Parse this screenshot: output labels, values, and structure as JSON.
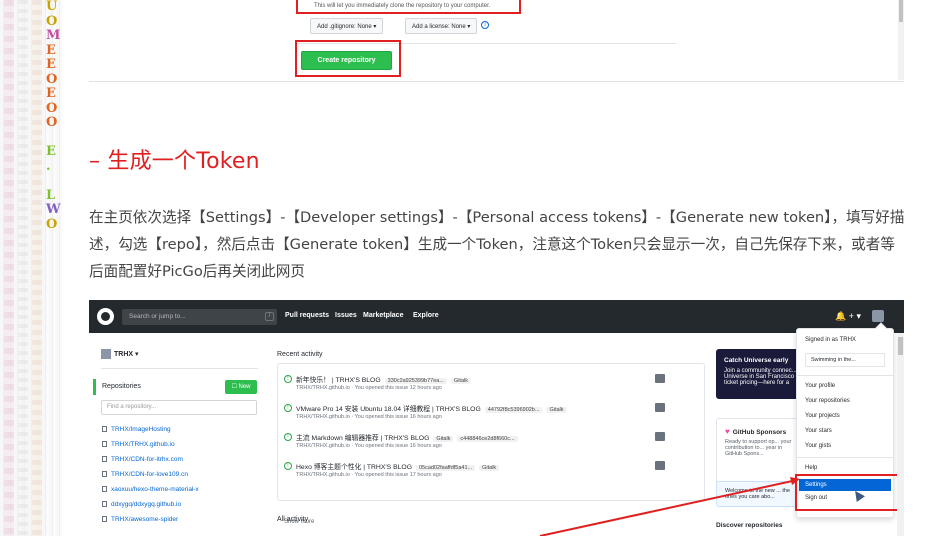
{
  "left_strip": {
    "letters": [
      {
        "ch": "U",
        "color": "#c9a400"
      },
      {
        "ch": "O",
        "color": "#c9a400"
      },
      {
        "ch": "M",
        "color": "#c24fa0"
      },
      {
        "ch": "E",
        "color": "#e0651f"
      },
      {
        "ch": "E",
        "color": "#e0651f"
      },
      {
        "ch": "O",
        "color": "#e0651f"
      },
      {
        "ch": "E",
        "color": "#e0651f"
      },
      {
        "ch": "O",
        "color": "#e0651f"
      },
      {
        "ch": "O",
        "color": "#e0651f"
      },
      {
        "ch": "",
        "color": "#999"
      },
      {
        "ch": "E",
        "color": "#80c030"
      },
      {
        "ch": ".",
        "color": "#80c030"
      },
      {
        "ch": "",
        "color": "#999"
      },
      {
        "ch": "L",
        "color": "#80c030"
      },
      {
        "ch": "W",
        "color": "#8060c0"
      },
      {
        "ch": "O",
        "color": "#c9a400"
      }
    ]
  },
  "top_screenshot": {
    "hint": "This will let you immediately clone the repository to your computer.",
    "gitignore_btn": "Add .gitignore: None ▾",
    "license_btn": "Add a license: None ▾",
    "info_icon": "i",
    "create_btn": "Create repository"
  },
  "article": {
    "heading": "– 生成一个Token",
    "paragraph": "在主页依次选择【Settings】-【Developer settings】-【Personal access tokens】-【Generate new token】，填写好描述，勾选【repo】，然后点击【Generate token】生成一个Token，注意这个Token只会显示一次，自己先保存下来，或者等后面配置好PicGo后再关闭此网页"
  },
  "github": {
    "search_placeholder": "Search or jump to...",
    "search_key": "/",
    "nav": [
      "Pull requests",
      "Issues",
      "Marketplace",
      "Explore"
    ],
    "header_right": "🔔  + ▾",
    "user": "TRHX ▾",
    "repos_title": "Repositories",
    "new_btn": "☐ New",
    "find_placeholder": "Find a repository...",
    "repos": [
      "TRHX/ImageHosting",
      "TRHX/TRHX.github.io",
      "TRHX/CDN-for-itrhx.com",
      "TRHX/CDN-for-love109.cn",
      "xaoxuu/hexo-theme-material-x",
      "ddxygq/ddxygq.github.io",
      "TRHX/awesome-spider"
    ],
    "recent_title": "Recent activity",
    "activities": [
      {
        "title": "新年快乐！ | TRHX'S BLOG",
        "tag1": "330c2a925399b77ea...",
        "tag2": "Gitalk",
        "sub": "TRHX/TRHX.github.io  ·  You opened this issue 12 hours ago"
      },
      {
        "title": "VMware Pro 14 安装 Ubuntu 18.04 详细教程 | TRHX'S BLOG",
        "tag1": "44792f8c5396902b...",
        "tag2": "Gitalk",
        "sub": "TRHX/TRHX.github.io  ·  You opened this issue 16 hours ago"
      },
      {
        "title": "主流 Markdown 编辑器推荐 | TRHX'S BLOG",
        "tag1": "Gitalk",
        "tag2": "c448846ce2d8f660c...",
        "sub": "TRHX/TRHX.github.io  ·  You opened this issue 16 hours ago"
      },
      {
        "title": "Hexo 博客主题个性化 | TRHX'S BLOG",
        "tag1": "05cad02faaffdf5a41...",
        "tag2": "Gitalk",
        "sub": "TRHX/TRHX.github.io  ·  You opened this issue 17 hours ago"
      }
    ],
    "show_more": "Show more",
    "all_title": "All activity",
    "universe_title": "Catch Universe early",
    "universe_text": "Join a community connec... Universe in San Francisco ticket pricing—here for a",
    "sponsor_title": "GitHub Sponsors",
    "sponsor_text": "Ready to support op... your contribution to... year in GitHub Spons...",
    "welcome_text": "Welcome to the new ... the ones you care abo...",
    "discover": "Discover repositories",
    "dropdown": {
      "signed_in": "Signed in as TRHX",
      "status": "Swimming in the...",
      "items_a": [
        "Your profile",
        "Your repositories",
        "Your projects",
        "Your stars",
        "Your gists"
      ],
      "help": "Help",
      "settings": "Settings",
      "signout": "Sign out"
    }
  },
  "colors": {
    "accent_red": "#e02020",
    "github_dark": "#24292e",
    "github_green": "#2cbe4e",
    "github_blue": "#0366d6"
  }
}
